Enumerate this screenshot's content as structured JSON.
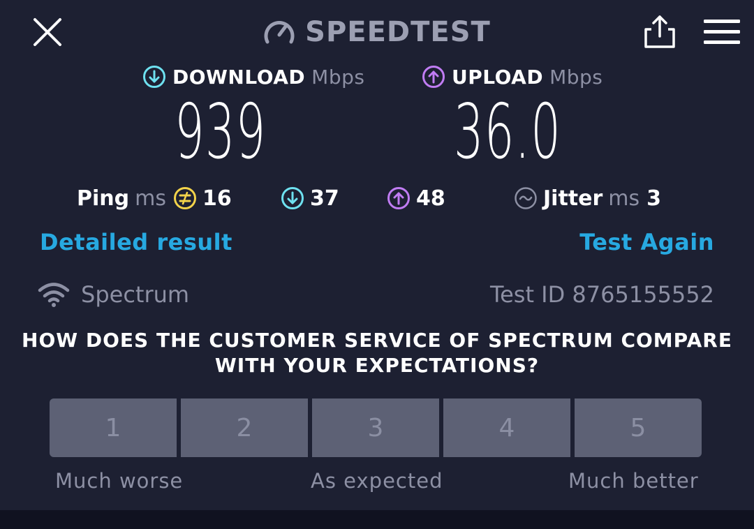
{
  "header": {
    "logo_text": "SPEEDTEST",
    "close_icon": "close-icon",
    "share_icon": "share-icon",
    "menu_icon": "menu-icon"
  },
  "download": {
    "label": "DOWNLOAD",
    "unit": "Mbps",
    "value": "939",
    "color": "#6ee1f0"
  },
  "upload": {
    "label": "UPLOAD",
    "unit": "Mbps",
    "value": "36.0",
    "color": "#c07cf3"
  },
  "ping": {
    "label": "Ping",
    "unit": "ms",
    "idle": "16",
    "download": "37",
    "upload": "48",
    "idle_color": "#f3d34a"
  },
  "jitter": {
    "label": "Jitter",
    "unit": "ms",
    "value": "3"
  },
  "links": {
    "detailed": "Detailed result",
    "test_again": "Test Again"
  },
  "provider": {
    "name": "Spectrum",
    "test_id": "Test ID 8765155552"
  },
  "survey": {
    "question_line1": "HOW DOES THE CUSTOMER SERVICE OF SPECTRUM COMPARE",
    "question_line2": "WITH YOUR EXPECTATIONS?",
    "options": [
      "1",
      "2",
      "3",
      "4",
      "5"
    ],
    "low_label": "Much worse",
    "mid_label": "As expected",
    "high_label": "Much better"
  },
  "colors": {
    "background": "#1d2032",
    "accent_link": "#27a9e1",
    "muted": "#8d90a4",
    "rating_button": "#5d6175"
  }
}
